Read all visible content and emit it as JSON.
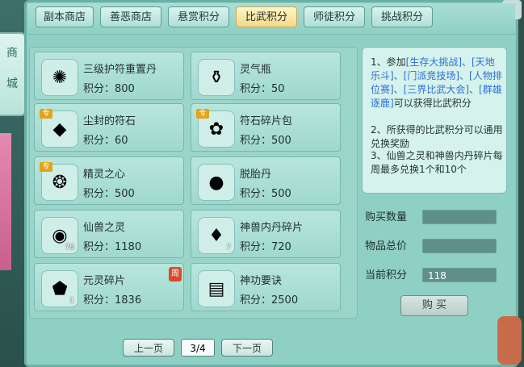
{
  "store": {
    "label_top": "商",
    "label_bottom": "城"
  },
  "tabs": [
    {
      "label": "副本商店",
      "active": false
    },
    {
      "label": "善恶商店",
      "active": false
    },
    {
      "label": "悬赏积分",
      "active": false
    },
    {
      "label": "比武积分",
      "active": true
    },
    {
      "label": "师徒积分",
      "active": false
    },
    {
      "label": "挑战积分",
      "active": false
    }
  ],
  "items": [
    {
      "name": "三级护符重置丹",
      "score": "积分：800",
      "icon": "amulet-icon"
    },
    {
      "name": "灵气瓶",
      "score": "积分：50",
      "icon": "bottle-icon"
    },
    {
      "name": "尘封的符石",
      "score": "积分：60",
      "icon": "rune-stone-icon",
      "badge": "专"
    },
    {
      "name": "符石碎片包",
      "score": "积分：500",
      "icon": "bag-icon",
      "badge": "专"
    },
    {
      "name": "精灵之心",
      "score": "积分：500",
      "icon": "heart-icon",
      "badge": "专"
    },
    {
      "name": "脱胎丹",
      "score": "积分：500",
      "icon": "pill-icon"
    },
    {
      "name": "仙兽之灵",
      "score": "积分：1180",
      "icon": "spirit-orb-icon",
      "count": "78"
    },
    {
      "name": "神兽内丹碎片",
      "score": "积分：720",
      "icon": "crystal-shard-icon",
      "count": "7"
    },
    {
      "name": "元灵碎片",
      "score": "积分：1836",
      "icon": "gold-fragment-icon",
      "count": "1",
      "week": "周"
    },
    {
      "name": "神功要诀",
      "score": "积分：2500",
      "icon": "book-icon"
    }
  ],
  "info": {
    "line1_prefix": "1、参加",
    "line1_links": "[生存大挑战]、[天地乐斗]、[门派竞技场]、[人物排位赛]、[三界比武大会]、[群雄逐鹿]",
    "line1_suffix": "可以获得比武积分",
    "line2": "2、所获得的比武积分可以通用兑换奖励",
    "line3": "3、仙兽之灵和神兽内丹碎片每周最多兑换1个和10个"
  },
  "purchase": {
    "qty_label": "购买数量",
    "total_label": "物品总价",
    "current_label": "当前积分",
    "current_value": "118",
    "buy_label": "购 买"
  },
  "pager": {
    "prev": "上一页",
    "next": "下一页",
    "page": "3/4"
  }
}
